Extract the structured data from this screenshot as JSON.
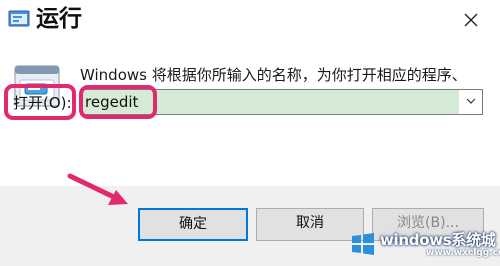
{
  "window": {
    "title": "运行",
    "icon": "run-dialog-icon",
    "close_icon": "close-icon"
  },
  "content": {
    "description": "Windows 将根据你所输入的名称，为你打开相应的程序、文件夹、文档或 Internet 资源。",
    "open_label": "打开(O):",
    "input_value": "regedit",
    "dropdown_icon": "chevron-down-icon"
  },
  "buttons": {
    "ok": "确定",
    "cancel": "取消",
    "browse": "浏览(B)..."
  },
  "watermark": {
    "text": "windows系统城",
    "sub": "www.wxclgg.com"
  },
  "colors": {
    "highlight": "#e4286f",
    "input_fill": "#d6ebd6",
    "accent": "#0078d7",
    "footer_bg": "#f0f0f0"
  }
}
